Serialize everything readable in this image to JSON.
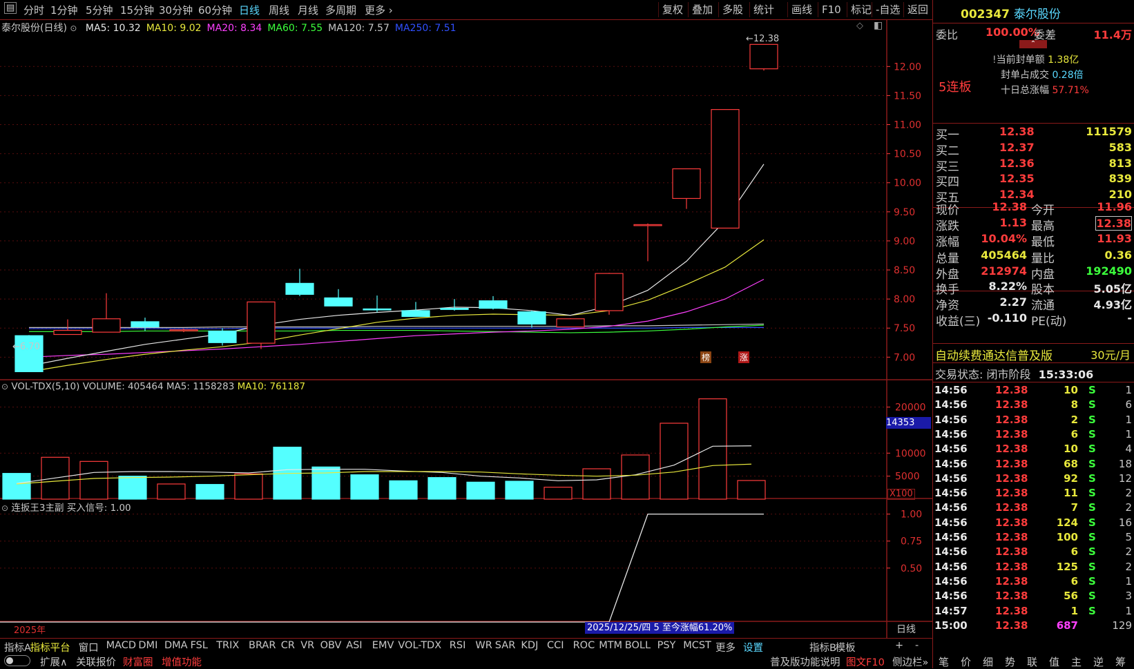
{
  "toolbar": {
    "periods": [
      "分时",
      "1分钟",
      "5分钟",
      "15分钟",
      "30分钟",
      "60分钟",
      "日线",
      "周线",
      "月线",
      "多周期",
      "更多"
    ],
    "active_period": "日线",
    "buttons": [
      "复权",
      "叠加",
      "多股",
      "统计",
      "画线",
      "F10",
      "标记",
      "-自选",
      "返回"
    ]
  },
  "main_chart": {
    "title": "泰尔股份(日线)",
    "ma_labels": [
      {
        "text": "MA5: 10.32",
        "color": "#e8e8e8"
      },
      {
        "text": "MA10: 9.02",
        "color": "#e8e83c"
      },
      {
        "text": "MA20: 8.34",
        "color": "#ff40ff"
      },
      {
        "text": "MA60: 7.55",
        "color": "#3cff3c"
      },
      {
        "text": "MA120: 7.57",
        "color": "#c8c8c8"
      },
      {
        "text": "MA250: 7.51",
        "color": "#3050ff"
      }
    ],
    "y_ticks": [
      "12.00",
      "11.50",
      "11.00",
      "10.50",
      "10.00",
      "9.50",
      "9.00",
      "8.50",
      "8.00",
      "7.50",
      "7.00"
    ],
    "high_marker": "12.38",
    "low_marker": "6.70",
    "badges": [
      "榜",
      "涨"
    ]
  },
  "volume_chart": {
    "title": "VOL-TDX(5,10)",
    "volume_label": "VOLUME: 405464",
    "ma5_label": "MA5: 1158283",
    "ma10_label": "MA10: 761187",
    "y_ticks": [
      "20000",
      "10000",
      "5000"
    ],
    "cursor_value": "14353",
    "unit": "X100"
  },
  "indicator_chart": {
    "title": "连扳王3主副",
    "signal_label": "买入信号: 1.00",
    "y_ticks": [
      "1.00",
      "0.75",
      "0.50"
    ],
    "year_label": "2025年",
    "info_bar": "2025/12/25/四 5 至今涨幅61.20%",
    "period_label": "日线"
  },
  "chart_data": {
    "type": "candlestick",
    "candles": [
      {
        "o": 7.37,
        "h": 7.38,
        "l": 6.75,
        "c": 6.75
      },
      {
        "o": 7.39,
        "h": 7.65,
        "l": 7.39,
        "c": 7.46
      },
      {
        "o": 7.43,
        "h": 8.1,
        "l": 7.43,
        "c": 7.66
      },
      {
        "o": 7.61,
        "h": 7.68,
        "l": 7.45,
        "c": 7.52
      },
      {
        "o": 7.47,
        "h": 7.49,
        "l": 7.43,
        "c": 7.47
      },
      {
        "o": 7.45,
        "h": 7.5,
        "l": 7.2,
        "c": 7.25
      },
      {
        "o": 7.24,
        "h": 7.96,
        "l": 7.14,
        "c": 7.95
      },
      {
        "o": 8.27,
        "h": 8.52,
        "l": 8.05,
        "c": 8.08
      },
      {
        "o": 8.02,
        "h": 8.17,
        "l": 7.9,
        "c": 7.88
      },
      {
        "o": 7.83,
        "h": 8.06,
        "l": 7.77,
        "c": 7.82
      },
      {
        "o": 7.8,
        "h": 7.95,
        "l": 7.7,
        "c": 7.7
      },
      {
        "o": 7.84,
        "h": 8.0,
        "l": 7.8,
        "c": 7.82
      },
      {
        "o": 7.97,
        "h": 8.05,
        "l": 7.82,
        "c": 7.84
      },
      {
        "o": 7.78,
        "h": 7.8,
        "l": 7.51,
        "c": 7.57
      },
      {
        "o": 7.52,
        "h": 7.67,
        "l": 7.52,
        "c": 7.66
      },
      {
        "o": 7.8,
        "h": 8.45,
        "l": 7.73,
        "c": 8.44
      },
      {
        "o": 9.28,
        "h": 9.3,
        "l": 8.65,
        "c": 9.28
      },
      {
        "o": 9.73,
        "h": 10.24,
        "l": 9.55,
        "c": 10.24
      },
      {
        "o": 9.22,
        "h": 11.26,
        "l": 9.22,
        "c": 11.26
      },
      {
        "o": 11.96,
        "h": 12.38,
        "l": 11.93,
        "c": 12.38
      }
    ],
    "ma5": [
      6.85,
      6.98,
      7.1,
      7.22,
      7.31,
      7.4,
      7.55,
      7.65,
      7.72,
      7.77,
      7.81,
      7.86,
      7.85,
      7.8,
      7.72,
      7.88,
      8.15,
      8.65,
      9.35,
      10.32
    ],
    "ma10": [
      6.75,
      6.86,
      6.96,
      7.05,
      7.12,
      7.18,
      7.26,
      7.38,
      7.49,
      7.6,
      7.67,
      7.72,
      7.74,
      7.73,
      7.72,
      7.8,
      7.98,
      8.25,
      8.55,
      9.02
    ],
    "ma20": [
      7.0,
      7.03,
      7.05,
      7.08,
      7.11,
      7.14,
      7.18,
      7.22,
      7.27,
      7.32,
      7.37,
      7.4,
      7.43,
      7.45,
      7.48,
      7.53,
      7.62,
      7.78,
      8.0,
      8.34
    ],
    "ma60": [
      7.44,
      7.44,
      7.44,
      7.45,
      7.45,
      7.45,
      7.45,
      7.45,
      7.46,
      7.46,
      7.46,
      7.45,
      7.44,
      7.43,
      7.42,
      7.43,
      7.45,
      7.48,
      7.52,
      7.55
    ],
    "ma120": [
      7.51,
      7.51,
      7.51,
      7.51,
      7.51,
      7.52,
      7.52,
      7.52,
      7.52,
      7.53,
      7.53,
      7.53,
      7.53,
      7.53,
      7.53,
      7.54,
      7.54,
      7.55,
      7.56,
      7.57
    ],
    "ma250": [
      7.49,
      7.49,
      7.49,
      7.49,
      7.49,
      7.49,
      7.5,
      7.5,
      7.5,
      7.5,
      7.5,
      7.5,
      7.5,
      7.5,
      7.5,
      7.5,
      7.5,
      7.51,
      7.51,
      7.51
    ],
    "volume": [
      5600,
      9100,
      8200,
      5000,
      3300,
      3200,
      5500,
      11300,
      7000,
      5300,
      4000,
      4700,
      3700,
      3900,
      2600,
      6600,
      9600,
      16500,
      21800,
      4054
    ],
    "vol_ma5": [
      3400,
      4600,
      5800,
      6000,
      6000,
      5900,
      5700,
      6400,
      6500,
      6500,
      6100,
      5800,
      5000,
      4600,
      4000,
      4200,
      5300,
      7400,
      11500,
      11582
    ],
    "vol_ma10": [
      3300,
      3900,
      4500,
      4700,
      4800,
      5000,
      5300,
      5600,
      5700,
      6000,
      6000,
      6000,
      5900,
      5500,
      5200,
      5000,
      5200,
      5900,
      7300,
      7612
    ],
    "signal": [
      0,
      0,
      0,
      0,
      0,
      0,
      0,
      0,
      0,
      0,
      0,
      0,
      0,
      0,
      0,
      0,
      1,
      1,
      1,
      1
    ],
    "price_ylim": [
      6.6,
      12.55
    ],
    "volume_ylim": [
      0,
      24000
    ],
    "signal_ylim": [
      0,
      1.1
    ]
  },
  "quote": {
    "code": "002347",
    "name": "泰尔股份",
    "webi_label": "委比",
    "webi_value": "100.00%",
    "weicha_label": "委差",
    "weicha_value": "11.4万",
    "limit_streak": "5连板",
    "seal_amount_label": "当前封单额",
    "seal_amount": "1.38亿",
    "seal_ratio_label": "封单占成交",
    "seal_ratio": "0.28倍",
    "ten_day_label": "十日总涨幅",
    "ten_day_value": "57.71%",
    "bids": [
      {
        "label": "买一",
        "price": "12.38",
        "vol": "111579"
      },
      {
        "label": "买二",
        "price": "12.37",
        "vol": "583"
      },
      {
        "label": "买三",
        "price": "12.36",
        "vol": "813"
      },
      {
        "label": "买四",
        "price": "12.35",
        "vol": "839"
      },
      {
        "label": "买五",
        "price": "12.34",
        "vol": "210"
      }
    ],
    "stats": [
      {
        "l1": "现价",
        "v1": "12.38",
        "c1": "red",
        "l2": "今开",
        "v2": "11.96",
        "c2": "red"
      },
      {
        "l1": "涨跌",
        "v1": "1.13",
        "c1": "red",
        "l2": "最高",
        "v2": "12.38",
        "c2": "red"
      },
      {
        "l1": "涨幅",
        "v1": "10.04%",
        "c1": "red",
        "l2": "最低",
        "v2": "11.93",
        "c2": "red"
      },
      {
        "l1": "总量",
        "v1": "405464",
        "c1": "yel",
        "l2": "量比",
        "v2": "0.36",
        "c2": "yel"
      },
      {
        "l1": "外盘",
        "v1": "212974",
        "c1": "red",
        "l2": "内盘",
        "v2": "192490",
        "c2": "grn"
      }
    ],
    "stats2": [
      {
        "l1": "换手",
        "v1": "8.22%",
        "l2": "股本",
        "v2": "5.05亿"
      },
      {
        "l1": "净资",
        "v1": "2.27",
        "l2": "流通",
        "v2": "4.93亿"
      },
      {
        "l1": "收益(三)",
        "v1": "-0.110",
        "l2": "PE(动)",
        "v2": "-"
      }
    ],
    "promo": "自动续费通达信普及版",
    "promo_price": "30元/月",
    "status_label": "交易状态:",
    "status_value": "闭市阶段",
    "status_time": "15:33:06"
  },
  "ticks": [
    {
      "t": "14:56",
      "p": "12.38",
      "v": "10",
      "s": "S",
      "n": "1"
    },
    {
      "t": "14:56",
      "p": "12.38",
      "v": "8",
      "s": "S",
      "n": "6"
    },
    {
      "t": "14:56",
      "p": "12.38",
      "v": "2",
      "s": "S",
      "n": "1"
    },
    {
      "t": "14:56",
      "p": "12.38",
      "v": "6",
      "s": "S",
      "n": "1"
    },
    {
      "t": "14:56",
      "p": "12.38",
      "v": "10",
      "s": "S",
      "n": "4"
    },
    {
      "t": "14:56",
      "p": "12.38",
      "v": "68",
      "s": "S",
      "n": "18"
    },
    {
      "t": "14:56",
      "p": "12.38",
      "v": "92",
      "s": "S",
      "n": "12"
    },
    {
      "t": "14:56",
      "p": "12.38",
      "v": "11",
      "s": "S",
      "n": "2"
    },
    {
      "t": "14:56",
      "p": "12.38",
      "v": "7",
      "s": "S",
      "n": "2"
    },
    {
      "t": "14:56",
      "p": "12.38",
      "v": "124",
      "s": "S",
      "n": "16"
    },
    {
      "t": "14:56",
      "p": "12.38",
      "v": "100",
      "s": "S",
      "n": "5"
    },
    {
      "t": "14:56",
      "p": "12.38",
      "v": "6",
      "s": "S",
      "n": "2"
    },
    {
      "t": "14:56",
      "p": "12.38",
      "v": "125",
      "s": "S",
      "n": "2"
    },
    {
      "t": "14:56",
      "p": "12.38",
      "v": "6",
      "s": "S",
      "n": "1"
    },
    {
      "t": "14:56",
      "p": "12.38",
      "v": "56",
      "s": "S",
      "n": "3"
    },
    {
      "t": "14:57",
      "p": "12.38",
      "v": "1",
      "s": "S",
      "n": "1"
    },
    {
      "t": "15:00",
      "p": "12.38",
      "v": "687",
      "s": "",
      "n": "129"
    }
  ],
  "indicator_tabs": [
    "指标A",
    "指标平台",
    "窗口",
    "MACD",
    "DMI",
    "DMA",
    "FSL",
    "TRIX",
    "BRAR",
    "CR",
    "VR",
    "OBV",
    "ASI",
    "EMV",
    "VOL-TDX",
    "RSI",
    "WR",
    "SAR",
    "KDJ",
    "CCI",
    "ROC",
    "MTM",
    "BOLL",
    "PSY",
    "MCST",
    "更多",
    "设置",
    "指标B",
    "模板",
    "+",
    "-"
  ],
  "status_bar": [
    "扩展∧",
    "关联报价",
    "财富圈",
    "增值功能",
    "普及版功能说明",
    "图文F10",
    "侧边栏»"
  ],
  "right_tabs": [
    "笔",
    "价",
    "细",
    "势",
    "联",
    "值",
    "主",
    "逆",
    "筹"
  ],
  "colors": {
    "up": "#ff3c3c",
    "down": "#54ffff",
    "border": "#8b1a1a"
  }
}
